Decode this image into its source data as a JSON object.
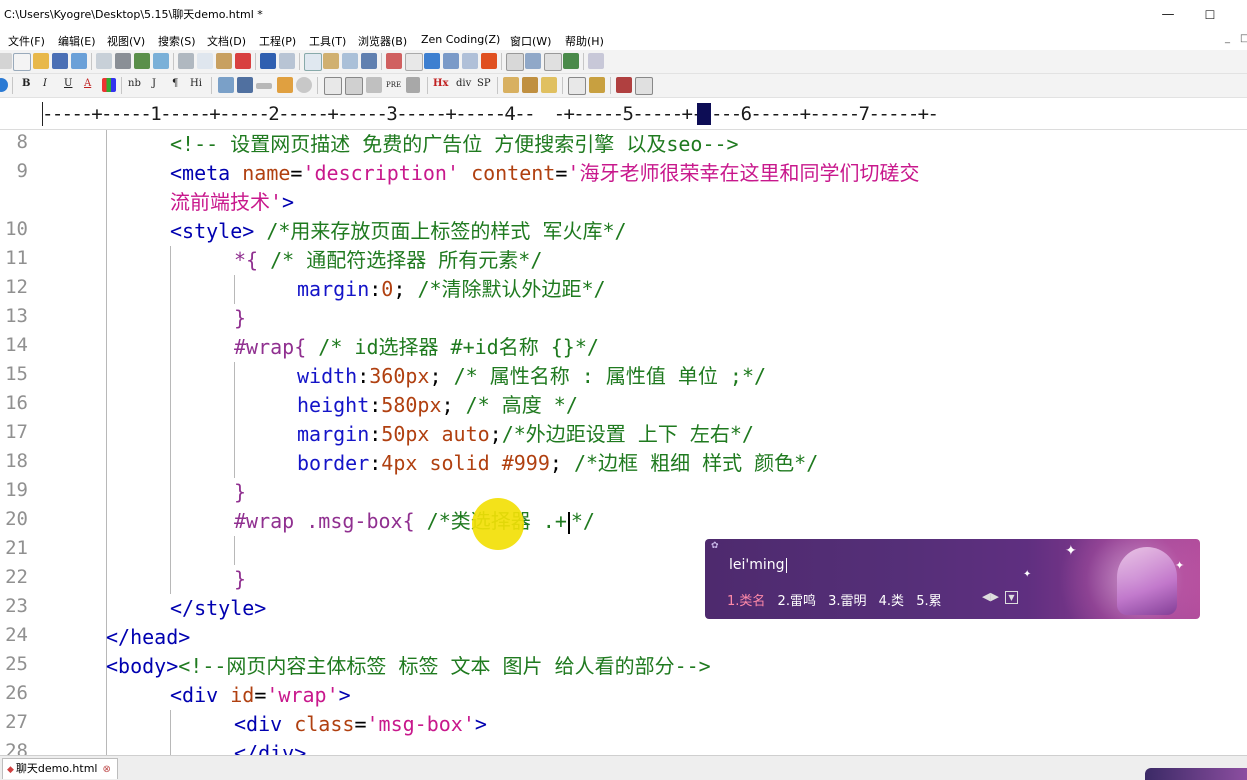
{
  "window": {
    "title": "C:\\Users\\Kyogre\\Desktop\\5.15\\聊天demo.html *",
    "minimize_glyph": "—",
    "maximize_glyph": "☐"
  },
  "menu": {
    "items": [
      "文件(F)",
      "编辑(E)",
      "视图(V)",
      "搜索(S)",
      "文档(D)",
      "工程(P)",
      "工具(T)",
      "浏览器(B)",
      "Zen Coding(Z)",
      "窗口(W)",
      "帮助(H)"
    ],
    "mdi_min": "_",
    "mdi_restore": "□"
  },
  "toolbar2": {
    "labels": [
      "B",
      "I",
      "U",
      "A",
      "nb",
      "J",
      "¶",
      "Hi",
      "PRE",
      "Hx",
      "div",
      "SP"
    ]
  },
  "ruler": {
    "text": "-----+-----1-----+-----2-----+-----3-----+-----4--  -+-----5-----+-----6-----+-----7-----+-"
  },
  "editor": {
    "lines": [
      {
        "num": "8",
        "segments": [
          [
            "cmt",
            "<!-- 设置网页描述 免费的广告位 方便搜索引擎 以及seo-->"
          ]
        ]
      },
      {
        "num": "9",
        "segments": [
          [
            "tag",
            "<meta "
          ],
          [
            "attr",
            "name"
          ],
          [
            "txt",
            "="
          ],
          [
            "str",
            "'description'"
          ],
          [
            "txt",
            " "
          ],
          [
            "attr",
            "content"
          ],
          [
            "txt",
            "="
          ],
          [
            "str",
            "'海牙老师很荣幸在这里和同学们切磋交"
          ]
        ]
      },
      {
        "num": "",
        "segments": [
          [
            "str",
            "流前端技术'"
          ],
          [
            "tag",
            ">"
          ]
        ]
      },
      {
        "num": "10",
        "segments": [
          [
            "tag",
            "<style>"
          ],
          [
            "txt",
            " "
          ],
          [
            "cmt",
            "/*用来存放页面上标签的样式 军火库*/"
          ]
        ]
      },
      {
        "num": "11",
        "segments": [
          [
            "sel",
            "*{"
          ],
          [
            "txt",
            " "
          ],
          [
            "cmt",
            "/* 通配符选择器 所有元素*/"
          ]
        ]
      },
      {
        "num": "12",
        "segments": [
          [
            "prop",
            "margin"
          ],
          [
            "txt",
            ":"
          ],
          [
            "val",
            "0"
          ],
          [
            "txt",
            "; "
          ],
          [
            "cmt",
            "/*清除默认外边距*/"
          ]
        ]
      },
      {
        "num": "13",
        "segments": [
          [
            "sel",
            "}"
          ]
        ]
      },
      {
        "num": "14",
        "segments": [
          [
            "sel",
            "#wrap{"
          ],
          [
            "txt",
            " "
          ],
          [
            "cmt",
            "/* id选择器 #+id名称 {}*/"
          ]
        ]
      },
      {
        "num": "15",
        "segments": [
          [
            "prop",
            "width"
          ],
          [
            "txt",
            ":"
          ],
          [
            "val",
            "360px"
          ],
          [
            "txt",
            "; "
          ],
          [
            "cmt",
            "/* 属性名称 : 属性值 单位 ;*/"
          ]
        ]
      },
      {
        "num": "16",
        "segments": [
          [
            "prop",
            "height"
          ],
          [
            "txt",
            ":"
          ],
          [
            "val",
            "580px"
          ],
          [
            "txt",
            "; "
          ],
          [
            "cmt",
            "/* 高度 */"
          ]
        ]
      },
      {
        "num": "17",
        "segments": [
          [
            "prop",
            "margin"
          ],
          [
            "txt",
            ":"
          ],
          [
            "val",
            "50px auto"
          ],
          [
            "txt",
            ";"
          ],
          [
            "cmt",
            "/*外边距设置 上下 左右*/"
          ]
        ]
      },
      {
        "num": "18",
        "segments": [
          [
            "prop",
            "border"
          ],
          [
            "txt",
            ":"
          ],
          [
            "val",
            "4px solid #999"
          ],
          [
            "txt",
            "; "
          ],
          [
            "cmt",
            "/*边框 粗细 样式 颜色*/"
          ]
        ]
      },
      {
        "num": "19",
        "segments": [
          [
            "sel",
            "}"
          ]
        ]
      },
      {
        "num": "20",
        "segments": [
          [
            "sel",
            "#wrap .msg-box{"
          ],
          [
            "txt",
            " "
          ],
          [
            "cmt",
            "/*类选择器 .+"
          ],
          [
            "cursor",
            ""
          ],
          [
            "cmt",
            "*/"
          ]
        ]
      },
      {
        "num": "21",
        "segments": []
      },
      {
        "num": "22",
        "segments": [
          [
            "sel",
            "}"
          ]
        ]
      },
      {
        "num": "23",
        "segments": [
          [
            "tag",
            "</style>"
          ]
        ]
      },
      {
        "num": "24",
        "segments": [
          [
            "tag",
            "</head>"
          ]
        ]
      },
      {
        "num": "25",
        "segments": [
          [
            "tag",
            "<body>"
          ],
          [
            "cmt",
            "<!--网页内容主体标签 标签 文本 图片 给人看的部分-->"
          ]
        ]
      },
      {
        "num": "26",
        "segments": [
          [
            "tag",
            "<div "
          ],
          [
            "attr",
            "id"
          ],
          [
            "txt",
            "="
          ],
          [
            "str",
            "'wrap'"
          ],
          [
            "tag",
            ">"
          ]
        ]
      },
      {
        "num": "27",
        "segments": [
          [
            "tag",
            "<div "
          ],
          [
            "attr",
            "class"
          ],
          [
            "txt",
            "="
          ],
          [
            "str",
            "'msg-box'"
          ],
          [
            "tag",
            ">"
          ]
        ]
      },
      {
        "num": "28",
        "segments": [
          [
            "tag",
            "</div>"
          ]
        ]
      }
    ]
  },
  "ime": {
    "pinyin": "lei'ming",
    "candidates": [
      "1.类名",
      "2.雷鸣",
      "3.雷明",
      "4.类",
      "5.累"
    ],
    "pager": "◀▶",
    "pager_box": "▼"
  },
  "tabbar": {
    "tab_label": "聊天demo.html",
    "modified_mark": "◆",
    "close_glyph": "⊗"
  }
}
